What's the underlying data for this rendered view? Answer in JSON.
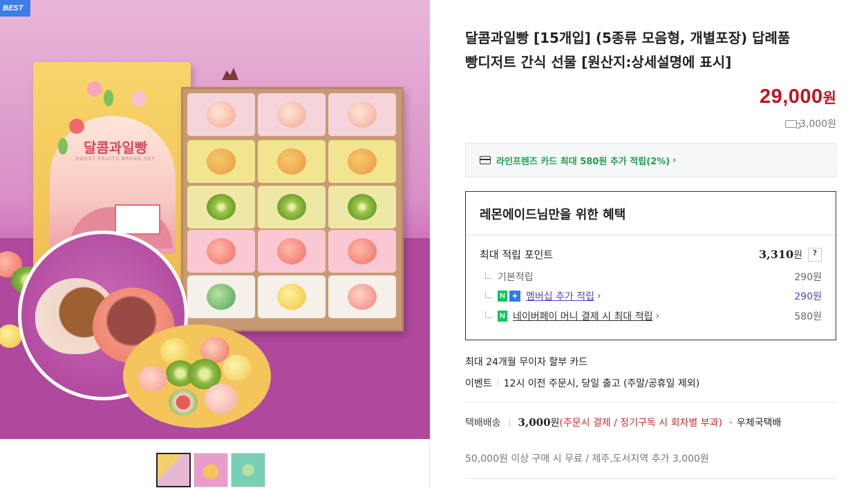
{
  "gallery": {
    "badge": "BEST",
    "lid_title": "달콤과일빵",
    "lid_subtitle": "SWEET FRUITS BREAD SET",
    "thumbnails": [
      "thumbnail-1",
      "thumbnail-2",
      "thumbnail-3"
    ]
  },
  "product": {
    "title_line1": "달콤과일빵 [15개입] (5종류 모음형, 개별포장) 답례품",
    "title_line2": "빵디저트 간식 선물 [원산지:상세설명에 표시]",
    "price": "29,000",
    "price_unit": "원",
    "shipping_fee": "3,000원"
  },
  "card_banner": {
    "text": "라인프렌즈 카드 최대 580원 추가 적립(2%)",
    "icon": "credit-card-icon",
    "color": "#1fa04e"
  },
  "benefit": {
    "title": "레몬에이드님만을 위한 혜택",
    "max_label": "최대 적립 포인트",
    "max_amount": "3,310",
    "max_unit": "원",
    "help": "?",
    "base_label": "기본적립",
    "base_amount": "290원",
    "member_badge": "N",
    "member_plus": "+",
    "member_label": "멤버십 추가 적립",
    "member_amount": "290원",
    "npay_badge": "N",
    "npay_label": "네이버페이 머니 결제 시 최대 적립",
    "npay_amount": "580원"
  },
  "installment": "최대 24개월 무이자 할부 카드",
  "event": {
    "label": "이벤트",
    "text": "12시 이전 주문시, 당일 출고 (주말/공휴일 제외)"
  },
  "delivery": {
    "label": "택배배송",
    "fee": "3,000",
    "fee_unit": "원",
    "note": "(주문시 결제 / 정기구독 시 회차별 부과)",
    "dot": "·",
    "carrier": "우체국택배",
    "free_note": "50,000원 이상 구매 시 무료 / 제주,도서지역 추가 3,000원"
  },
  "colors": {
    "price": "#c4121f",
    "naver_green": "#03c75a",
    "membership_purple": "#5a3fc0"
  }
}
